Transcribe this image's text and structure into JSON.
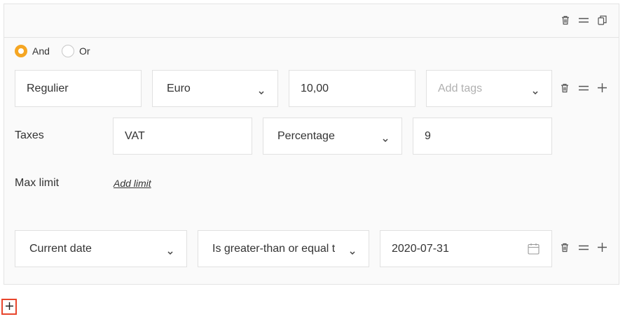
{
  "logic": {
    "options": [
      {
        "label": "And",
        "selected": true
      },
      {
        "label": "Or",
        "selected": false
      }
    ]
  },
  "row1": {
    "name": "Regulier",
    "currency": "Euro",
    "amount": "10,00",
    "tags_placeholder": "Add tags"
  },
  "taxes": {
    "label": "Taxes",
    "name": "VAT",
    "type": "Percentage",
    "value": "9"
  },
  "max_limit": {
    "label": "Max limit",
    "link": "Add limit"
  },
  "condition": {
    "field": "Current date",
    "operator": "Is greater-than or equal t",
    "value": "2020-07-31"
  },
  "icons": {
    "trash": "trash-icon",
    "drag": "drag-handle-icon",
    "duplicate": "duplicate-icon",
    "add": "plus-icon",
    "chevron": "chevron-down-icon",
    "calendar": "calendar-icon"
  },
  "colors": {
    "accent": "#f5a623",
    "highlight": "#e8452c"
  }
}
